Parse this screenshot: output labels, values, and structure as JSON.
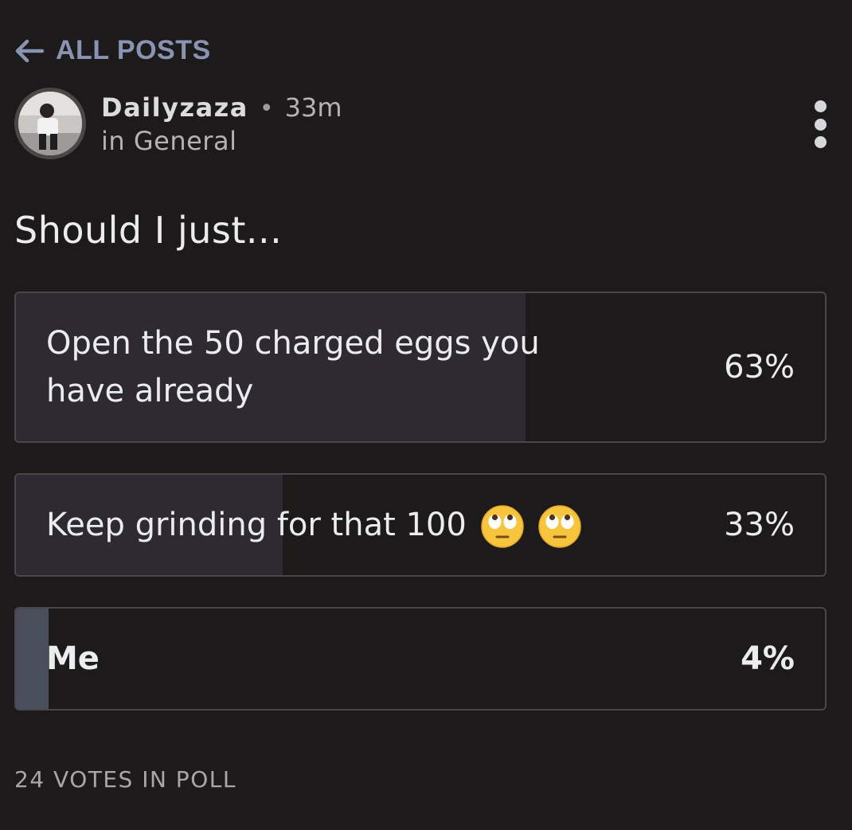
{
  "nav": {
    "back_label": "ALL POSTS"
  },
  "post": {
    "author": "Dailyzaza",
    "separator": "•",
    "time": "33m",
    "category": "in General",
    "title": "Should I just..."
  },
  "poll": {
    "options": [
      {
        "label": "Open the 50 charged eggs you have already",
        "percent": "63%",
        "fraction": 0.63
      },
      {
        "label": "Keep grinding for that 100",
        "percent": "33%",
        "fraction": 0.33,
        "emoji_icons": [
          "face-with-rolling-eyes-icon",
          "face-with-rolling-eyes-icon"
        ]
      },
      {
        "label": "Me",
        "percent": "4%",
        "fraction": 0.04
      }
    ],
    "votes_text": "24 VOTES IN POLL"
  },
  "colors": {
    "background": "#1c1a1b",
    "accent_link": "#8b93b3",
    "bar_fill": "#2d2a31",
    "bar_fill_selected": "#4a4d5b",
    "border": "#48464a"
  }
}
